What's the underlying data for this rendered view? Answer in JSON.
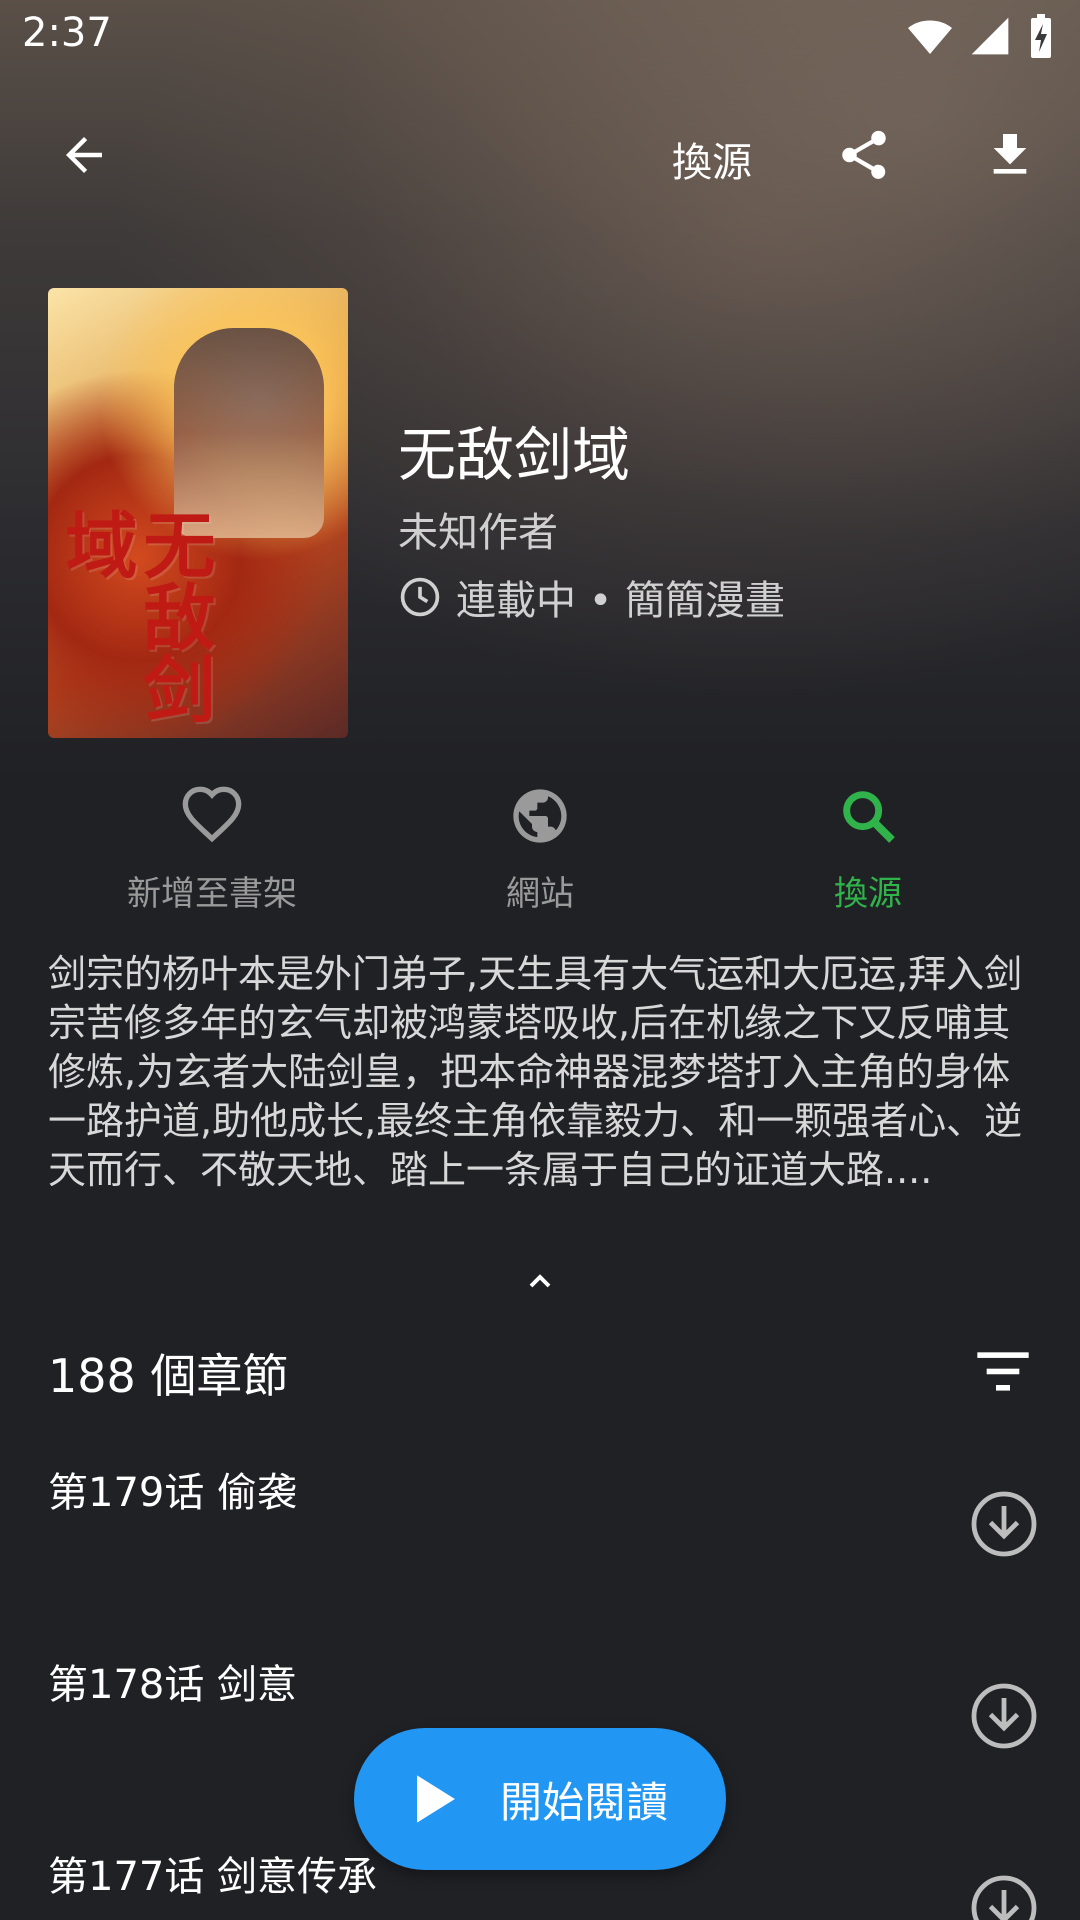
{
  "status_bar": {
    "time": "2:37"
  },
  "toolbar": {
    "back_icon": "arrow-back-icon",
    "source_label": "換源",
    "share_icon": "share-icon",
    "download_icon": "download-icon"
  },
  "book": {
    "title": "无敌剑域",
    "author": "未知作者",
    "meta": "連載中 • 簡簡漫畫",
    "cover_title_art": "无敌剑域"
  },
  "actions": [
    {
      "label": "新增至書架",
      "icon": "heart-outline-icon"
    },
    {
      "label": "網站",
      "icon": "globe-icon"
    },
    {
      "label": "換源",
      "icon": "search-icon",
      "color": "#2fb34a"
    }
  ],
  "description": "剑宗的杨叶本是外门弟子,天生具有大气运和大厄运,拜入剑宗苦修多年的玄气却被鸿蒙塔吸收,后在机缘之下又反哺其修炼,为玄者大陆剑皇，把本命神器混梦塔打入主角的身体一路护道,助他成长,最终主角依靠毅力、和一颗强者心、逆天而行、不敬天地、踏上一条属于自己的证道大路....",
  "chapters": {
    "count_label": "188 個章節",
    "items": [
      {
        "name": "第179话 偷袭"
      },
      {
        "name": "第178话 剑意"
      },
      {
        "name": "第177话 剑意传承"
      }
    ]
  },
  "fab": {
    "label": "開始閱讀",
    "color": "#2196f3"
  }
}
